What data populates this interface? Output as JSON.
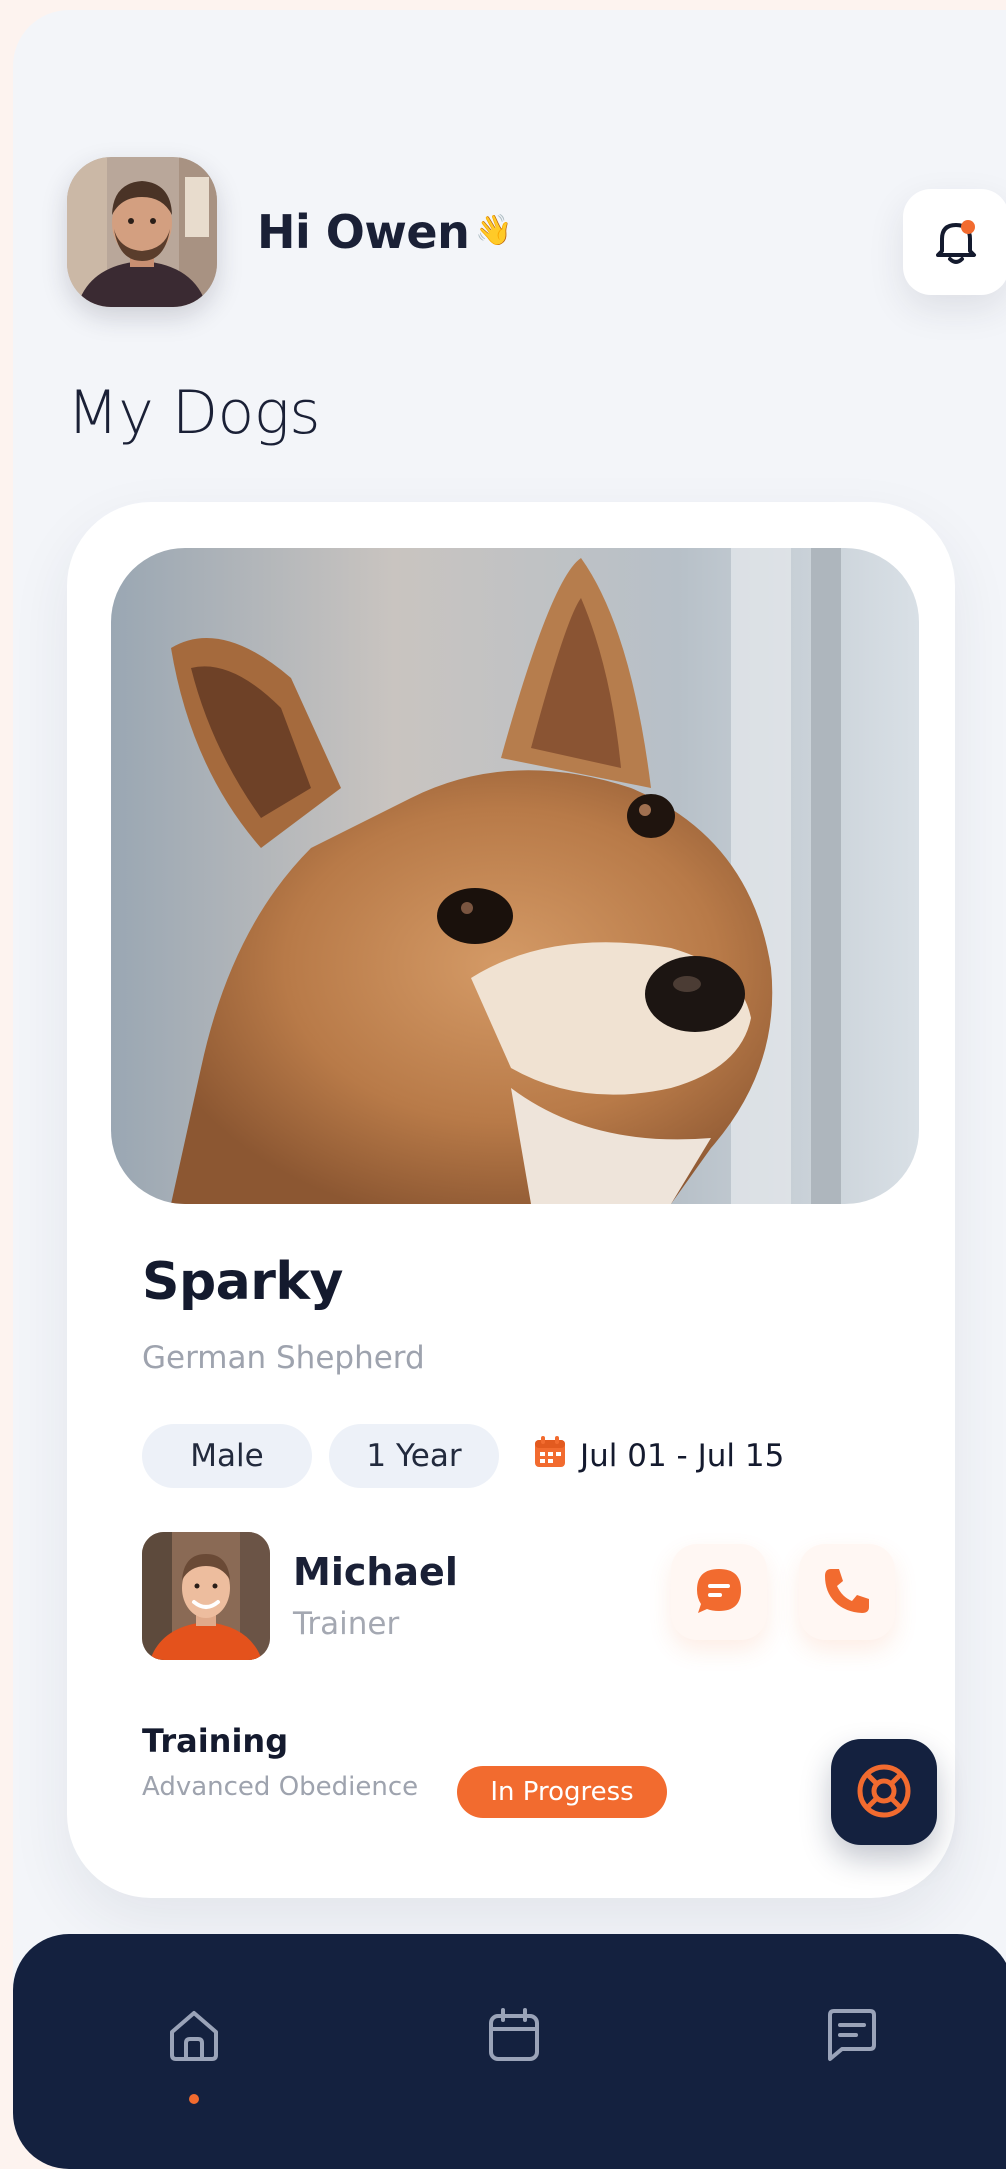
{
  "user": {
    "greeting": "Hi Owen",
    "wave_emoji": "👋",
    "avatar": "user-avatar-photo"
  },
  "notifications": {
    "icon": "bell-icon",
    "has_unread": true
  },
  "section": {
    "title": "My Dogs"
  },
  "dog": {
    "photo": "dog-photo",
    "name": "Sparky",
    "breed": "German Shepherd",
    "gender": "Male",
    "age": "1 Year",
    "date_range": "Jul 01 - Jul 15",
    "date_icon": "calendar-icon"
  },
  "trainer": {
    "name": "Michael",
    "role": "Trainer",
    "photo": "trainer-avatar-photo",
    "actions": [
      "chat-icon",
      "phone-icon"
    ]
  },
  "training": {
    "title": "Training",
    "program": "Advanced Obedience",
    "status": "In Progress"
  },
  "help": {
    "icon": "lifebuoy-icon"
  },
  "nav": {
    "items": [
      "home-icon",
      "calendar-icon",
      "messages-icon"
    ],
    "active": "home-icon"
  },
  "colors": {
    "accent": "#f26b2f",
    "navy": "#14213f",
    "background": "#f3f5f9",
    "chip": "#edf1f8"
  }
}
